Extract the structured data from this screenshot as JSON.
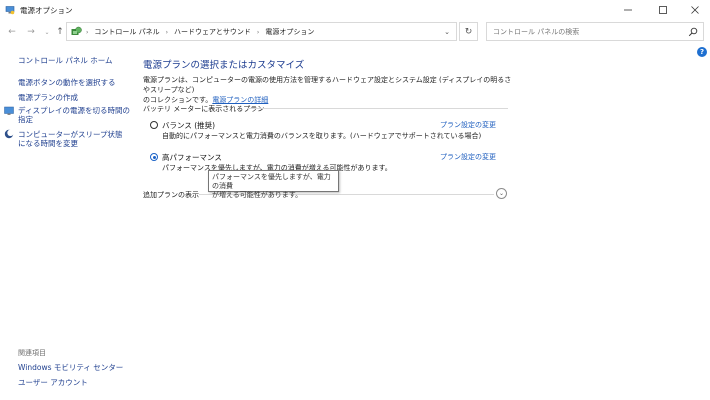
{
  "window": {
    "title": "電源オプション",
    "minimize_label": "—",
    "maximize_label": "☐",
    "close_label": "✕"
  },
  "nav": {
    "back": "←",
    "forward": "→",
    "recent": "⌄",
    "up": "↑"
  },
  "address": {
    "breadcrumbs": [
      "コントロール パネル",
      "ハードウェアとサウンド",
      "電源オプション"
    ],
    "separator": "›",
    "dropdown": "⌄",
    "refresh": "↻"
  },
  "search": {
    "placeholder": "コントロール パネルの検索"
  },
  "help": {
    "label": "?"
  },
  "sidebar": {
    "home": "コントロール パネル ホーム",
    "links": [
      {
        "label": "電源ボタンの動作を選択する"
      },
      {
        "label": "電源プランの作成"
      },
      {
        "label": "ディスプレイの電源を切る時間の指定"
      },
      {
        "label": "コンピューターがスリープ状態になる時間を変更"
      }
    ],
    "related_heading": "関連項目",
    "related": [
      {
        "label": "Windows モビリティ センター"
      },
      {
        "label": "ユーザー アカウント"
      }
    ]
  },
  "main": {
    "title": "電源プランの選択またはカスタマイズ",
    "description_line1": "電源プランは、コンピューターの電源の使用方法を管理するハードウェア設定とシステム設定 (ディスプレイの明るさやスリープなど)",
    "description_line2_prefix": "のコレクションです。",
    "description_link": "電源プランの詳細",
    "battery_section": "バッテリ メーターに表示されるプラン",
    "plans": [
      {
        "name": "バランス (推奨)",
        "description": "自動的にパフォーマンスと電力消費のバランスを取ります。(ハードウェアでサポートされている場合)",
        "change_link": "プラン設定の変更",
        "selected": false
      },
      {
        "name": "高パフォーマンス",
        "description": "パフォーマンスを優先しますが、電力の消費が増える可能性があります。",
        "change_link": "プラン設定の変更",
        "selected": true
      }
    ],
    "tooltip_line1": "パフォーマンスを優先しますが、電力の消費",
    "tooltip_line2": "が増える可能性があります。",
    "extra_plans": "追加プランの表示",
    "expand": "⌄"
  },
  "colors": {
    "link": "#1f3f8f",
    "accent": "#1b62c6",
    "title": "#1a3a8f"
  }
}
